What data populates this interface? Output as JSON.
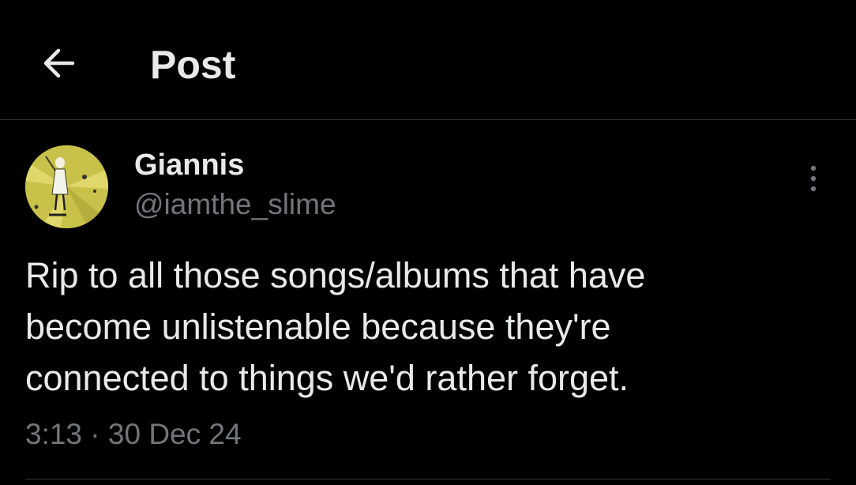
{
  "header": {
    "back_icon": "arrow-left-icon",
    "title": "Post"
  },
  "author": {
    "display_name": "Giannis",
    "handle": "@iamthe_slime",
    "avatar_icon": "avatar-image"
  },
  "post": {
    "text": "Rip to all those songs/albums that have\nbecome unlistenable because they're\nconnected to things we'd rather forget.",
    "time": "3:13",
    "separator": "·",
    "date": "30 Dec 24",
    "more_icon": "more-vertical-icon"
  },
  "colors": {
    "background": "#000000",
    "primary_text": "#e7e9ea",
    "secondary_text": "#71767b",
    "divider": "#2f3336",
    "avatar_accent": "#c9c24a"
  }
}
